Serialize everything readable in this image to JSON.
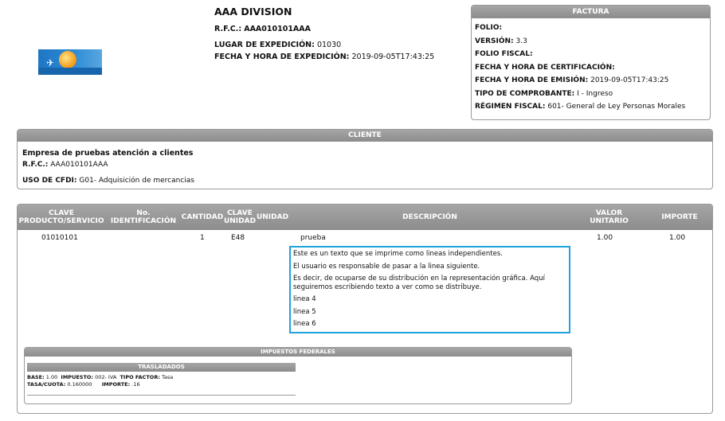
{
  "emisor": {
    "nombre": "AAA DIVISION",
    "rfc_label": "R.F.C.:",
    "rfc": "AAA010101AAA",
    "lugar_label": "LUGAR  DE EXPEDICIÓN:",
    "lugar": "01030",
    "fecha_label": "FECHA Y HORA DE EXPEDICIÓN:",
    "fecha": "2019-09-05T17:43:25"
  },
  "factura": {
    "title": "FACTURA",
    "folio_label": "FOLIO:",
    "version_label": "VERSIÓN:",
    "version": "3.3",
    "folio_fiscal_label": "FOLIO FISCAL:",
    "certificacion_label": "FECHA Y HORA DE CERTIFICACIÓN:",
    "emision_label": "FECHA Y HORA DE EMISIÓN:",
    "emision": "2019-09-05T17:43:25",
    "tipo_label": "TIPO DE COMPROBANTE:",
    "tipo": "I - Ingreso",
    "regimen_label": "RÉGIMEN FISCAL:",
    "regimen": "601- General de Ley Personas Morales"
  },
  "cliente": {
    "title": "CLIENTE",
    "nombre": "Empresa de pruebas atención a clientes",
    "rfc_label": "R.F.C.:",
    "rfc": "AAA010101AAA",
    "uso_label": "USO DE CFDI:",
    "uso": "G01- Adquisición de mercancias"
  },
  "conceptos": {
    "headers": {
      "clave_1": "CLAVE",
      "clave_2": "PRODUCTO/SERVICIO",
      "identificacion": "No. IDENTIFICACIÓN",
      "cantidad": "CANTIDAD",
      "clave_unidad_1": "CLAVE",
      "clave_unidad_2": "UNIDAD",
      "unidad": "UNIDAD",
      "descripcion": "DESCRIPCIÓN",
      "valor_1": "VALOR",
      "valor_2": "UNITARIO",
      "importe": "IMPORTE"
    },
    "row": {
      "clave": "01010101",
      "cantidad": "1",
      "clave_unidad": "E48",
      "descripcion": "prueba",
      "valor": "1.00",
      "importe": "1.00"
    },
    "desc_lines": [
      "Este es un texto que se imprime como lineas independientes.",
      "El usuario es responsable de pasar a la linea siguiente.",
      "Es decir, de ocuparse de su distribución en la representación gráfica. Aquí",
      "seguiremos escribiendo texto a ver como se distribuye.",
      "linea 4",
      "linea 5",
      "linea 6"
    ]
  },
  "impuestos": {
    "title": "IMPUESTOS FEDERALES",
    "trasladados_title": "TRASLADADOS",
    "base_label": "BASE:",
    "base": "1.00",
    "impuesto_label": "IMPUESTO:",
    "impuesto": "002- IVA",
    "factor_label": "TIPO FACTOR:",
    "factor": "Tasa",
    "tasa_label": "TASA/CUOTA:",
    "tasa": "0.160000",
    "importe_label": "IMPORTE:",
    "importe": ".16"
  },
  "colors": {
    "header_gray": "#999999",
    "highlight_border": "#1ea3dc",
    "logo_blue": "#1f76c2"
  }
}
